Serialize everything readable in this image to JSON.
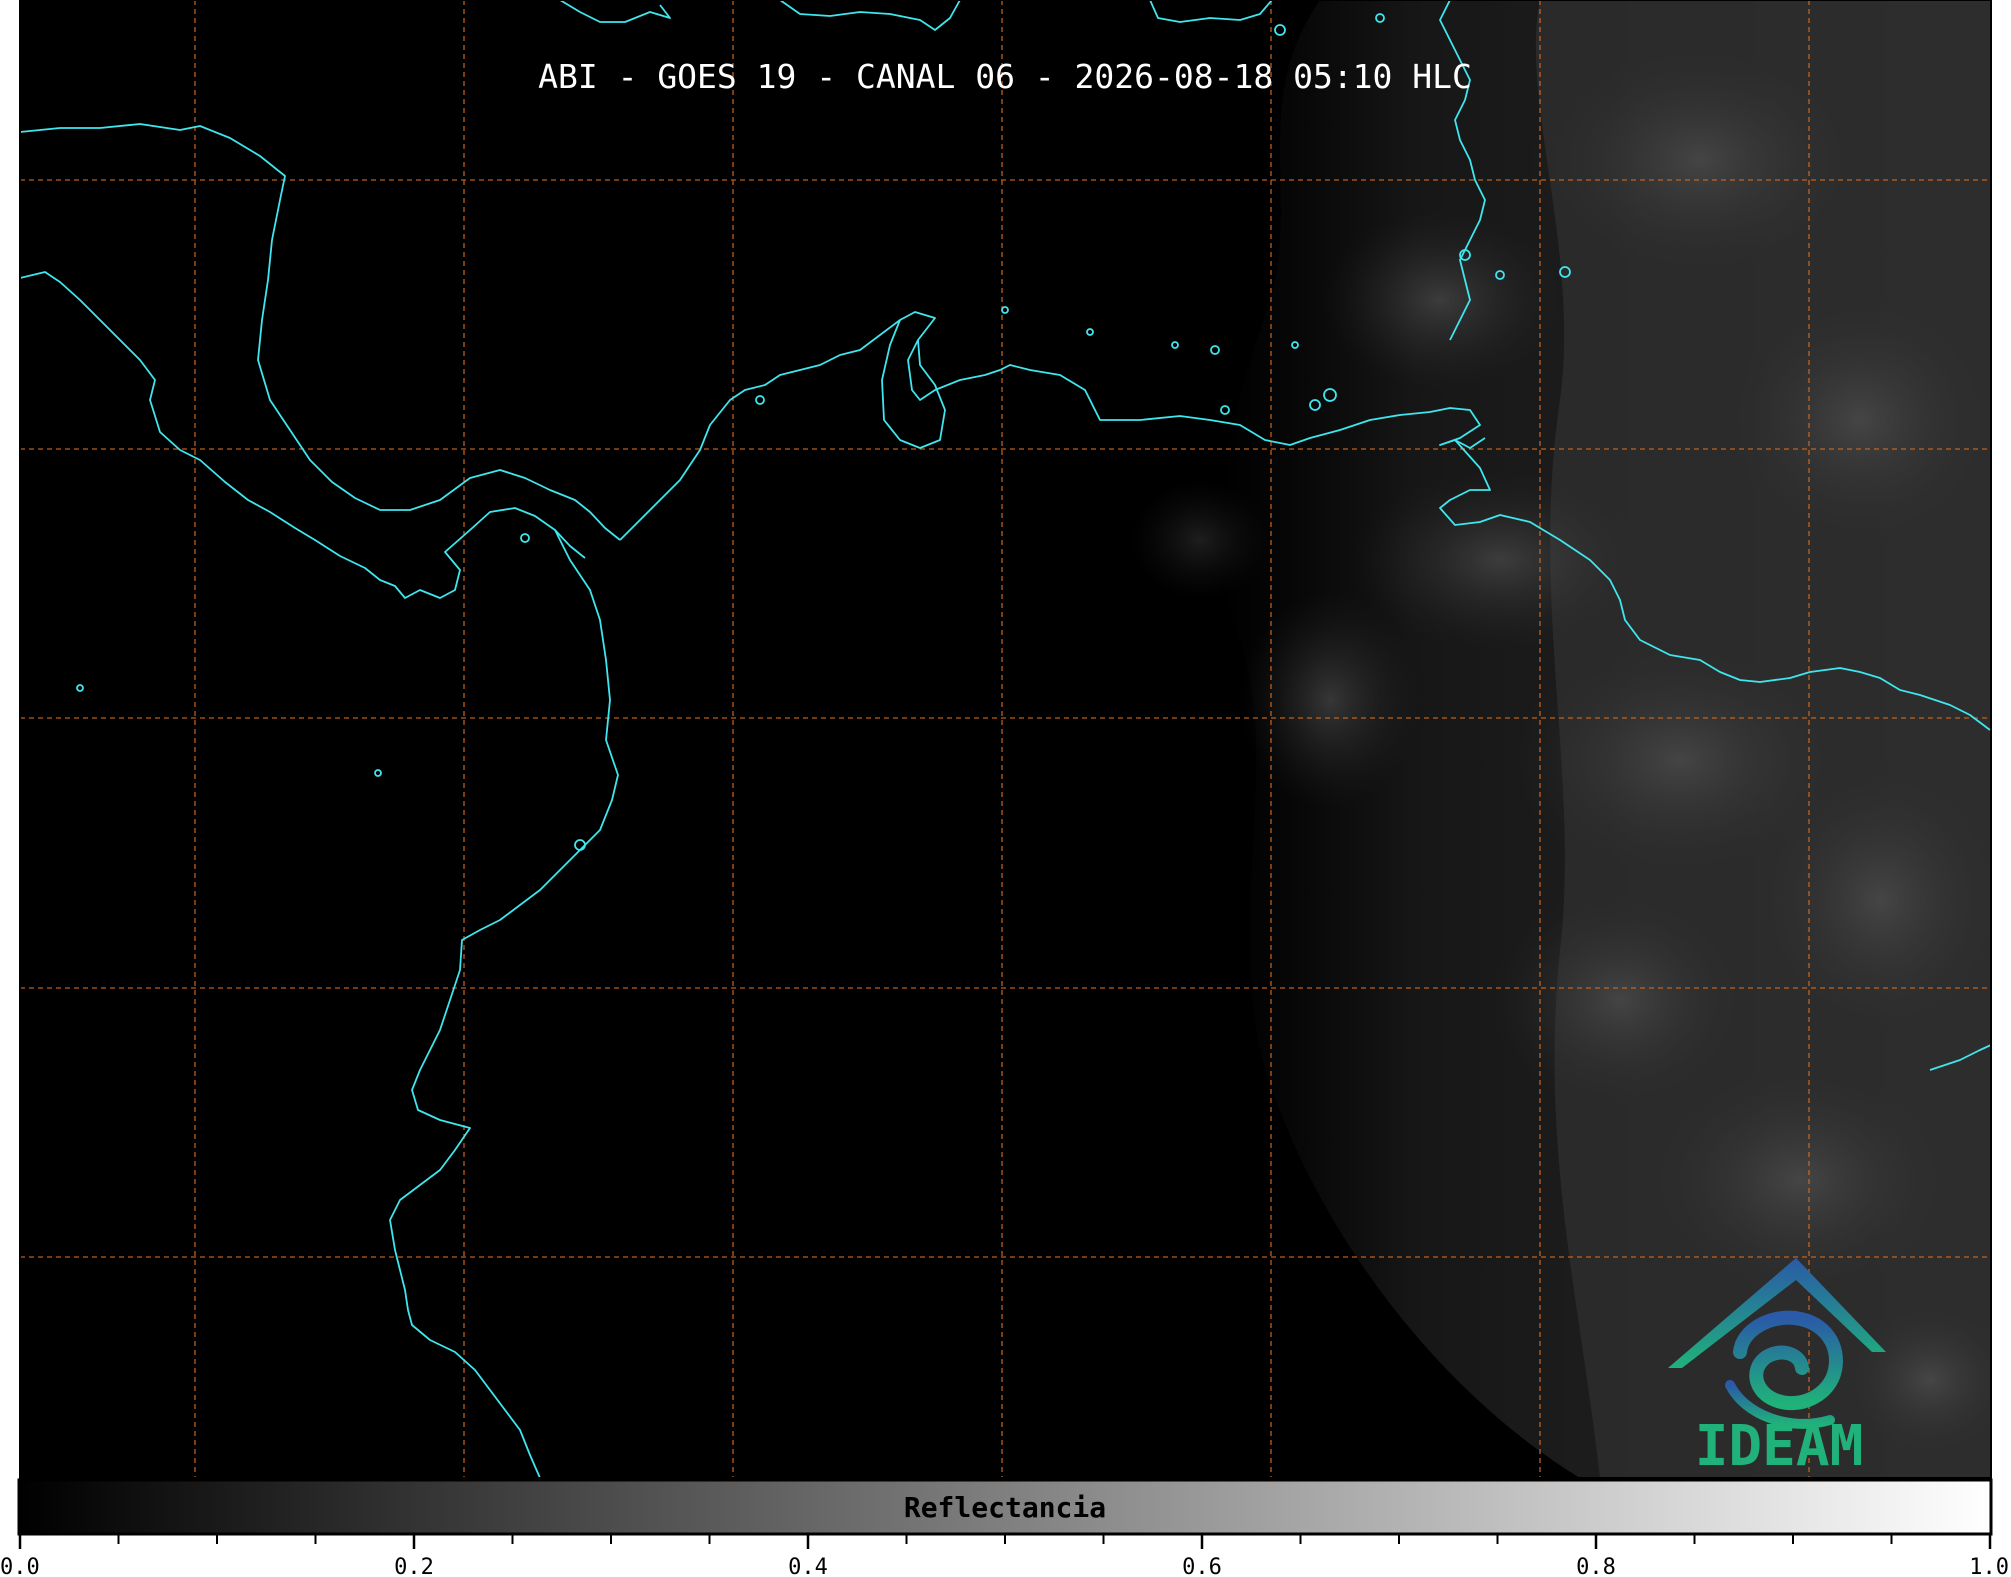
{
  "title": "ABI - GOES 19 - CANAL 06 - 2026-08-18 05:10 HLC",
  "logo": {
    "text": "IDEAM",
    "icon": "ideam-mountain-swirl-logo",
    "color": "#20b27a"
  },
  "colorbar": {
    "label": "Reflectancia",
    "min": 0.0,
    "max": 1.0,
    "colormap": "grayscale",
    "tick_labels": [
      "0.0",
      "0.2",
      "0.4",
      "0.6",
      "0.8",
      "1.0"
    ],
    "minor_step": 0.05
  },
  "map": {
    "background": "#000000",
    "coastline_color": "#3fe6ee",
    "graticule_color": "#d2691e",
    "graticule_style": "dashed",
    "grid": true
  }
}
